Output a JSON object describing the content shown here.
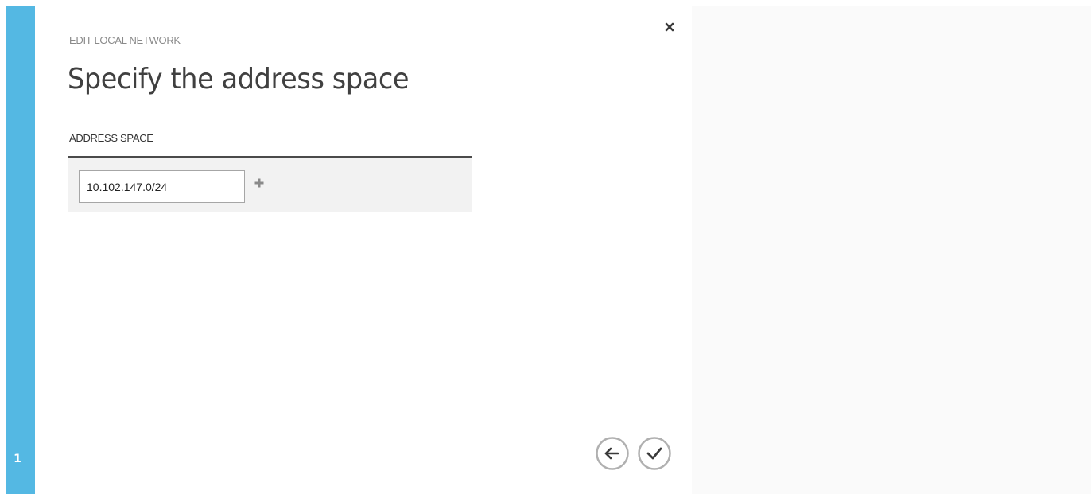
{
  "wizard": {
    "overline": "EDIT LOCAL NETWORK",
    "title": "Specify the address space",
    "current_step": "1",
    "close_icon": "close-icon"
  },
  "address_space": {
    "label": "ADDRESS SPACE",
    "entries": [
      {
        "value": "10.102.147.0/24"
      }
    ],
    "add_icon": "plus-icon"
  },
  "footer": {
    "back_icon": "arrow-left-icon",
    "confirm_icon": "checkmark-icon"
  },
  "colors": {
    "accent": "#54b8e3",
    "table_border": "#4a4a4a",
    "table_background": "#f2f2f2",
    "icon_gray": "#b0b0b0"
  }
}
